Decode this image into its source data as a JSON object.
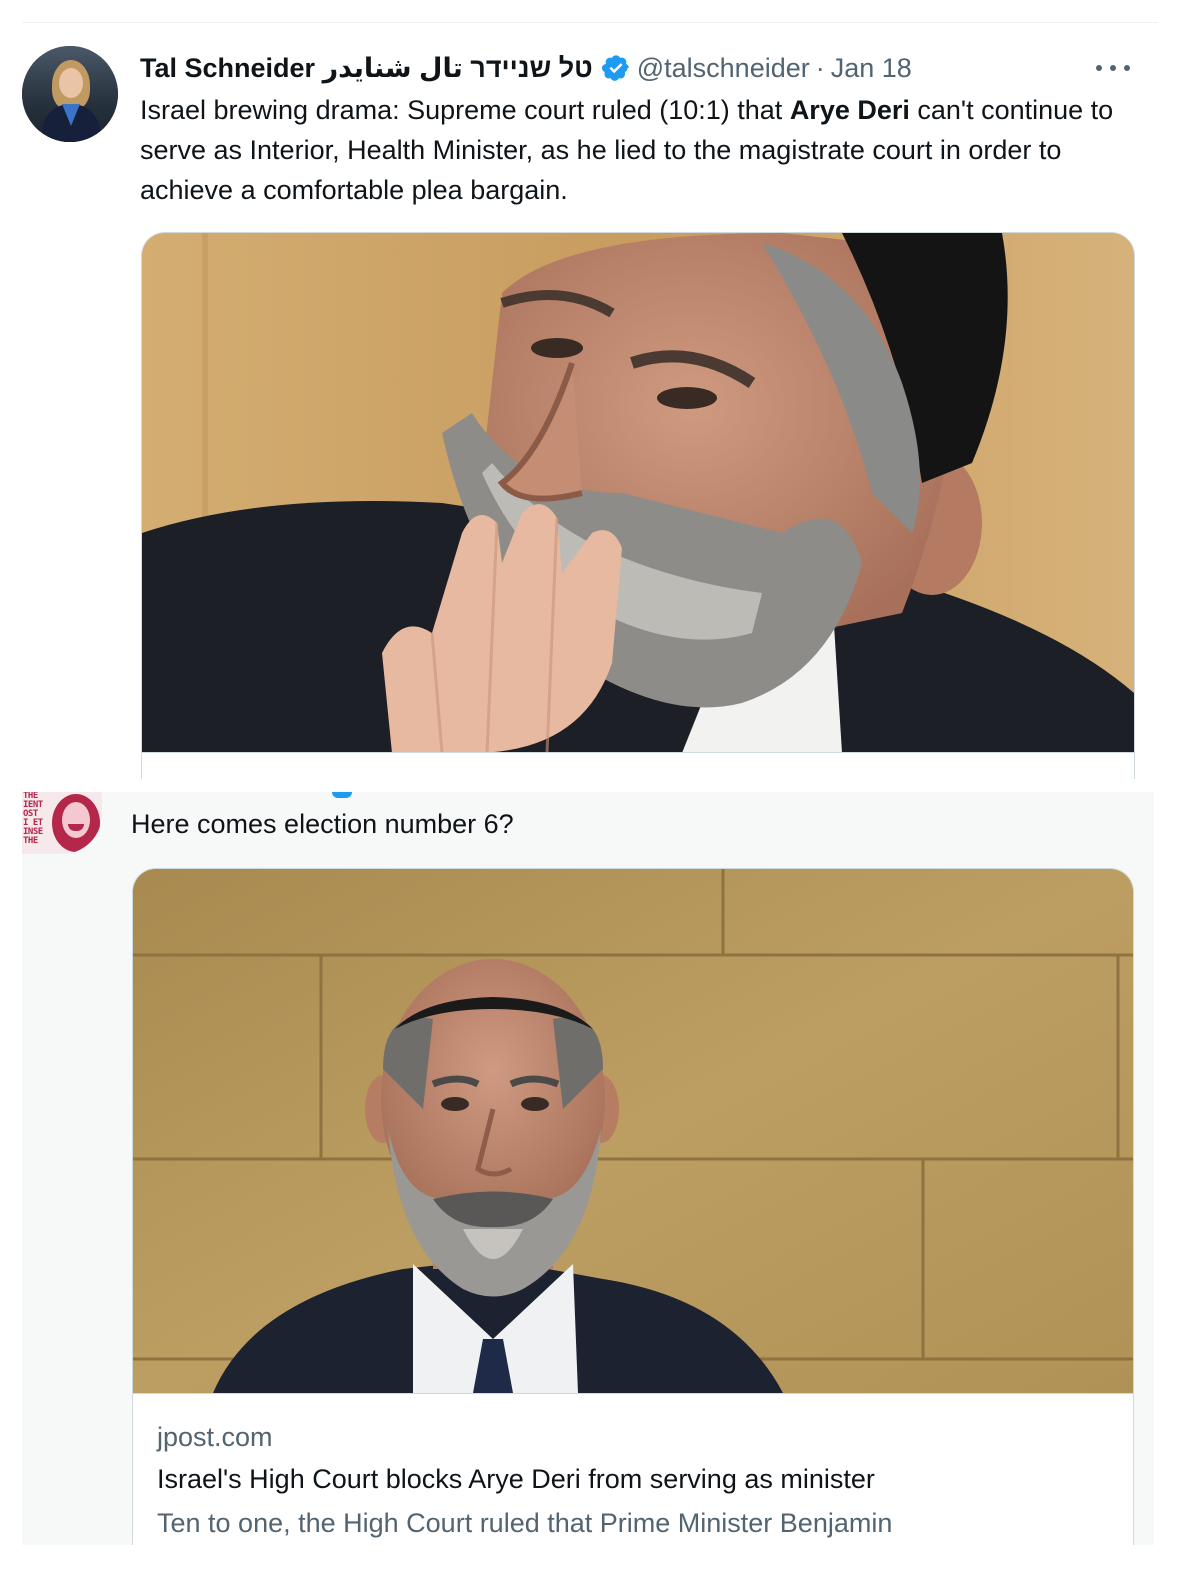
{
  "tweet1": {
    "author_name": "Tal Schneider טל שניידר تال شنايدر",
    "handle": "@talschneider",
    "separator": "·",
    "date": "Jan 18",
    "text_before": "Israel brewing drama: Supreme court ruled (10:1) that ",
    "text_bold": "Arye Deri",
    "text_after": " can't continue to serve as Interior, Health Minister, as he lied to the magistrate court in order to achieve a comfortable plea bargain."
  },
  "tweet2": {
    "avatar_logo_text": "THE\nIENT\nOST\nI ET\nINSE\nTHE",
    "text": "Here comes election number 6?",
    "card": {
      "domain": "jpost.com",
      "title": "Israel's High Court blocks Arye Deri from serving as minister",
      "description": "Ten to one, the High Court ruled that Prime Minister Benjamin"
    }
  },
  "colors": {
    "text_primary": "#0f1419",
    "text_secondary": "#536471",
    "verified_blue": "#1d9bf0",
    "border": "#cfd9de",
    "tweet2_background": "#f7f9f9"
  },
  "icons": {
    "verified": "verified-badge-icon",
    "more": "more-options-icon"
  }
}
